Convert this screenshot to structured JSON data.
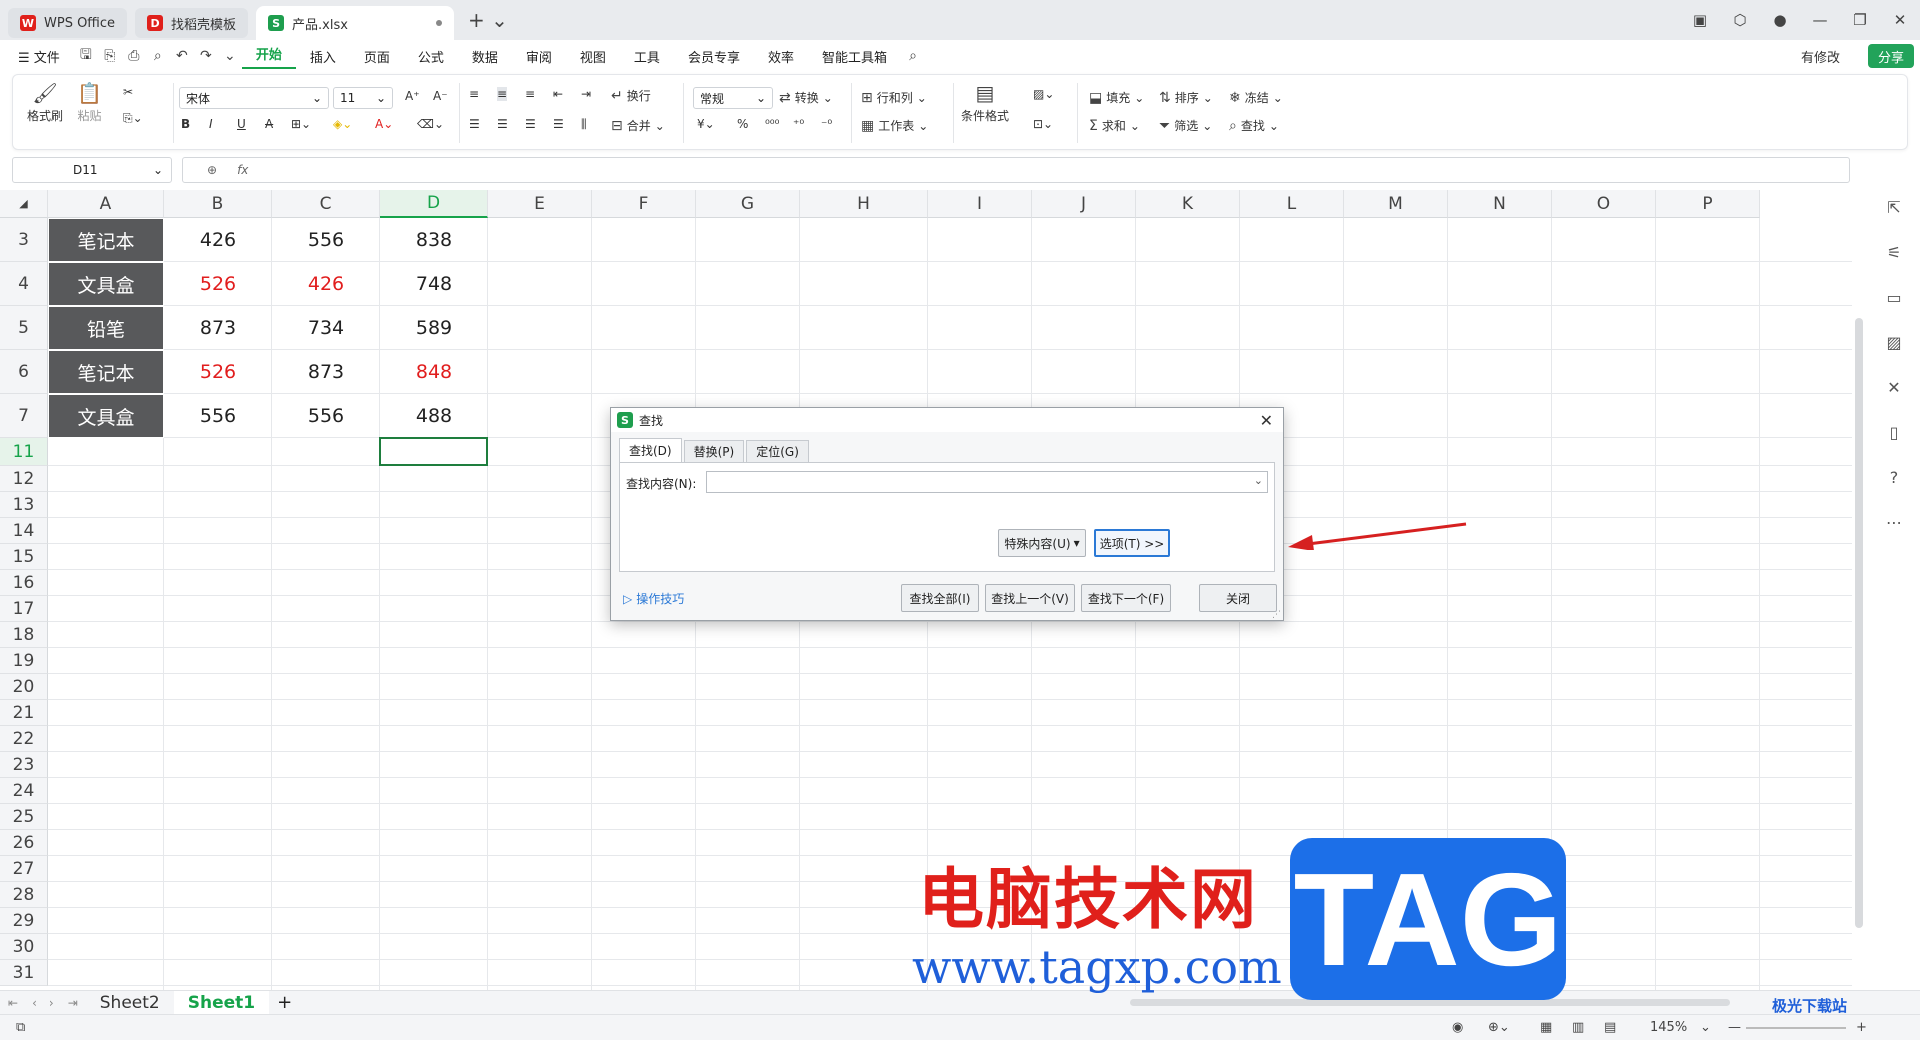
{
  "tabs": [
    {
      "label": "WPS Office",
      "logo": "W"
    },
    {
      "label": "找稻壳模板",
      "logo": "D"
    },
    {
      "label": "产品.xlsx",
      "logo": "S"
    }
  ],
  "menu": {
    "file": "文件",
    "items": [
      "开始",
      "插入",
      "页面",
      "公式",
      "数据",
      "审阅",
      "视图",
      "工具",
      "会员专享",
      "效率",
      "智能工具箱"
    ],
    "active_index": 0,
    "modified": "有修改",
    "share": "分享"
  },
  "ribbon": {
    "format_painter": "格式刷",
    "paste": "粘贴",
    "font_name": "宋体",
    "font_size": "11",
    "wrap": "换行",
    "merge": "合并",
    "number_format": "常规",
    "convert": "转换",
    "row_col": "行和列",
    "worksheet": "工作表",
    "cond_format": "条件格式",
    "fill": "填充",
    "sort": "排序",
    "freeze": "冻结",
    "sum": "求和",
    "filter": "筛选",
    "find": "查找"
  },
  "formula_bar": {
    "name_box": "D11",
    "fx": "fx"
  },
  "sheet": {
    "columns": [
      "A",
      "B",
      "C",
      "D",
      "E",
      "F",
      "G",
      "H",
      "I",
      "J",
      "K",
      "L",
      "M",
      "N",
      "O",
      "P"
    ],
    "selected_column": "D",
    "row_labels": [
      "3",
      "4",
      "5",
      "6",
      "7",
      "11",
      "12",
      "13",
      "14",
      "15",
      "16",
      "17",
      "18",
      "19",
      "20",
      "21",
      "22",
      "23",
      "24",
      "25",
      "26",
      "27",
      "28",
      "29",
      "30",
      "31"
    ],
    "selected_row": "11",
    "data": [
      {
        "a": "笔记本",
        "b": "426",
        "c": "556",
        "d": "838",
        "red": []
      },
      {
        "a": "文具盒",
        "b": "526",
        "c": "426",
        "d": "748",
        "red": [
          "b",
          "c"
        ]
      },
      {
        "a": "铅笔",
        "b": "873",
        "c": "734",
        "d": "589",
        "red": []
      },
      {
        "a": "笔记本",
        "b": "526",
        "c": "873",
        "d": "848",
        "red": [
          "b",
          "d"
        ]
      },
      {
        "a": "文具盒",
        "b": "556",
        "c": "556",
        "d": "488",
        "red": []
      }
    ]
  },
  "sheet_tabs": [
    "Sheet2",
    "Sheet1"
  ],
  "active_sheet": "Sheet1",
  "status": {
    "zoom": "145%"
  },
  "dialog": {
    "title": "查找",
    "tabs": [
      "查找(D)",
      "替换(P)",
      "定位(G)"
    ],
    "find_label": "查找内容(N):",
    "find_value": "",
    "special": "特殊内容(U)",
    "options": "选项(T) >>",
    "tips": "操作技巧",
    "find_all": "查找全部(I)",
    "find_prev": "查找上一个(V)",
    "find_next": "查找下一个(F)",
    "close": "关闭"
  },
  "watermark": {
    "cn": "电脑技术网",
    "url": "www.tagxp.com",
    "tag": "TAG",
    "site": "极光下载站"
  },
  "colors": {
    "accent": "#16a34a",
    "red": "#e11d1d",
    "dark_cell": "#58595b",
    "arrow": "#d62020"
  }
}
